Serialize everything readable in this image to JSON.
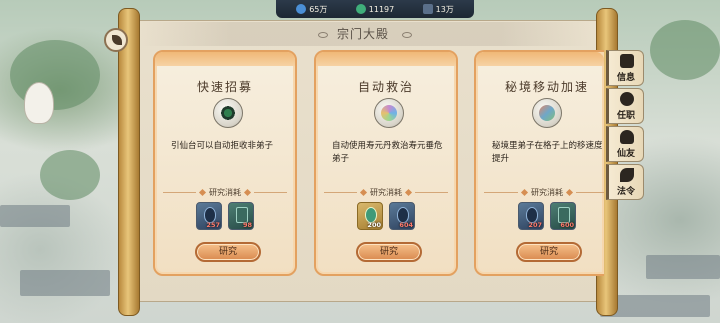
{
  "resources": [
    {
      "name": "water-drop",
      "value": "65万",
      "color": "#4b8fd6"
    },
    {
      "name": "jade-coin",
      "value": "11197",
      "color": "#3fae7a"
    },
    {
      "name": "spirit-stone",
      "value": "13万",
      "color": "#5a6f8a"
    }
  ],
  "panel": {
    "title": "宗门大殿"
  },
  "cards": [
    {
      "title": "快速招募",
      "icon": "recruit-icon",
      "desc": "引仙台可以自动拒收非弟子",
      "cost_label": "研究消耗",
      "items": [
        {
          "icon": "blue-crystal",
          "count": "257",
          "enough": false
        },
        {
          "icon": "teal-scroll",
          "count": "98",
          "enough": false
        }
      ],
      "button": "研究"
    },
    {
      "title": "自动救治",
      "icon": "heal-icon",
      "desc": "自动使用寿元丹救治寿元垂危弟子",
      "cost_label": "研究消耗",
      "items": [
        {
          "icon": "gold-pill",
          "count": "200",
          "enough": true
        },
        {
          "icon": "blue-crystal",
          "count": "604",
          "enough": false
        }
      ],
      "button": "研究"
    },
    {
      "title": "秘境移动加速",
      "icon": "speed-icon",
      "desc": "秘境里弟子在格子上的移速度提升",
      "cost_label": "研究消耗",
      "items": [
        {
          "icon": "blue-crystal",
          "count": "207",
          "enough": false
        },
        {
          "icon": "teal-scroll",
          "count": "600",
          "enough": false
        }
      ],
      "button": "研究"
    }
  ],
  "side_tabs": [
    {
      "label": "信息",
      "icon": "book-icon"
    },
    {
      "label": "任职",
      "icon": "seal-icon"
    },
    {
      "label": "仙友",
      "icon": "friends-icon"
    },
    {
      "label": "法令",
      "icon": "decree-icon"
    }
  ]
}
